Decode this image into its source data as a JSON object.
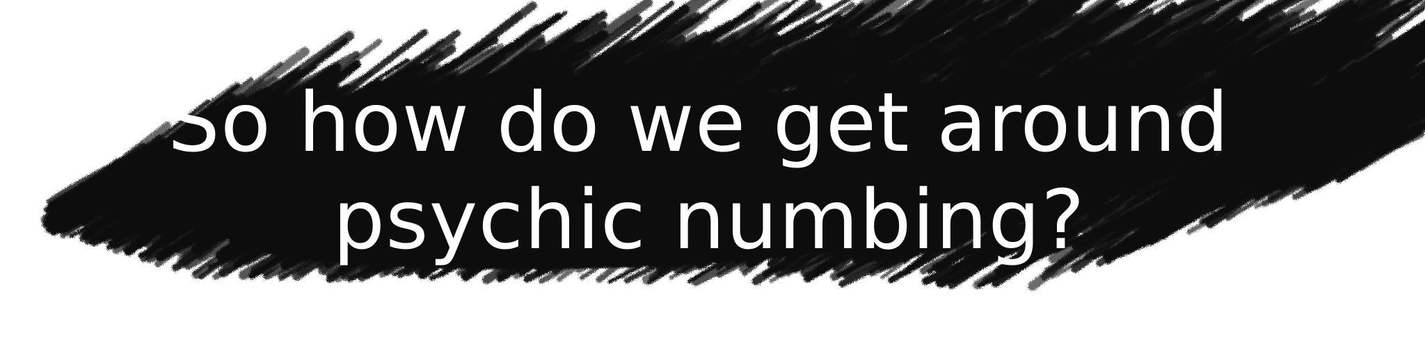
{
  "slide": {
    "headline": {
      "line1": "So how do we get around",
      "line2": "psychic numbing?"
    }
  },
  "colors": {
    "background": "#ffffff",
    "scribble": "#0b0b0b",
    "text": "#ffffff"
  },
  "icons": {
    "background_mark": "charcoal-scribble-icon"
  }
}
